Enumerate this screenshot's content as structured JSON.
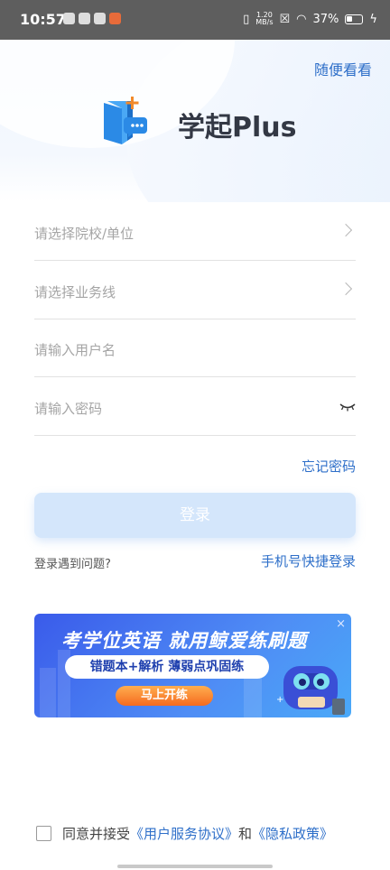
{
  "status_bar": {
    "time": "10:57",
    "net_speed_value": "1.20",
    "net_speed_unit": "MB/s",
    "battery": "37%"
  },
  "header": {
    "skip_label": "随便看看",
    "app_name": "学起Plus",
    "logo_icon": "book-chat-plus-icon"
  },
  "form": {
    "school_placeholder": "请选择院校/单位",
    "business_line_placeholder": "请选择业务线",
    "username_placeholder": "请输入用户名",
    "password_placeholder": "请输入密码",
    "forgot_password": "忘记密码",
    "login_button": "登录",
    "login_problem": "登录遇到问题?",
    "phone_login": "手机号快捷登录"
  },
  "banner": {
    "title": "考学位英语 就用鲸爱练刷题",
    "subtitle": "错题本+解析  薄弱点巩固练",
    "cta": "马上开练",
    "close": "×"
  },
  "agreement": {
    "prefix": "同意并接受",
    "user_agreement": "《用户服务协议》",
    "and": "和",
    "privacy_policy": "《隐私政策》"
  },
  "colors": {
    "accent": "#2e6fc9",
    "login_button_disabled": "#d4e6fb",
    "status_bar": "#5e5e5e"
  }
}
